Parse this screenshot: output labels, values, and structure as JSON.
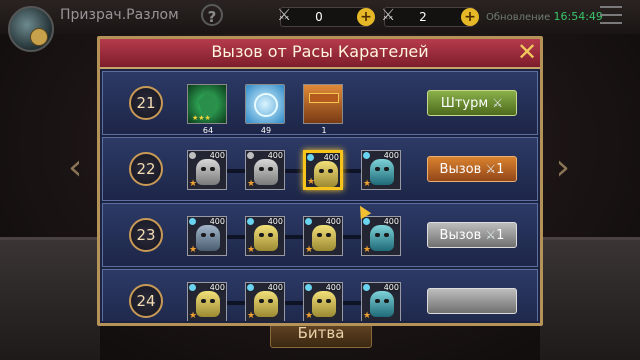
{
  "topbar": {
    "location": "Призрач.Разлом",
    "help_icon": "?",
    "resource1": {
      "value": "0",
      "icon": "crossed-swords-icon"
    },
    "resource2": {
      "value": "2",
      "icon": "crossed-swords-icon"
    },
    "plus_label": "+",
    "update_label": "Обновление",
    "update_time": "16:54:49"
  },
  "dialog": {
    "title": "Вызов от Расы Карателей",
    "close_label": "✕",
    "rows": [
      {
        "number": "21",
        "rewards": [
          {
            "kind": "green-gem",
            "count": "64",
            "stars": "★★★"
          },
          {
            "kind": "blue-orb",
            "count": "49"
          },
          {
            "kind": "chest",
            "count": "1"
          }
        ],
        "button": {
          "label": "Штурм",
          "icon": "⚔",
          "style": "green"
        }
      },
      {
        "number": "22",
        "enemies": [
          {
            "level": "400",
            "color": "grey",
            "dot": "grey"
          },
          {
            "level": "400",
            "color": "grey",
            "dot": "grey"
          },
          {
            "level": "400",
            "color": "yellow",
            "dot": "cyan",
            "selected": true
          },
          {
            "level": "400",
            "color": "teal",
            "dot": "cyan"
          }
        ],
        "button": {
          "label": "Вызов",
          "icon": "⚔",
          "count": "1",
          "style": "orange"
        }
      },
      {
        "number": "23",
        "enemies": [
          {
            "level": "400",
            "color": "bluegrey",
            "dot": "cyan"
          },
          {
            "level": "400",
            "color": "yellow",
            "dot": "cyan"
          },
          {
            "level": "400",
            "color": "yellow",
            "dot": "cyan"
          },
          {
            "level": "400",
            "color": "teal",
            "dot": "cyan"
          }
        ],
        "button": {
          "label": "Вызов",
          "icon": "⚔",
          "count": "1",
          "style": "grey"
        }
      },
      {
        "number": "24",
        "enemies": [
          {
            "level": "400",
            "color": "yellow",
            "dot": "cyan"
          },
          {
            "level": "400",
            "color": "yellow",
            "dot": "cyan"
          },
          {
            "level": "400",
            "color": "yellow",
            "dot": "cyan"
          },
          {
            "level": "400",
            "color": "teal",
            "dot": "cyan"
          }
        ],
        "button": {
          "label": "",
          "style": "grey"
        }
      }
    ]
  },
  "background": {
    "battle_label": "Битва",
    "nav_left": "‹",
    "nav_right": "›"
  }
}
